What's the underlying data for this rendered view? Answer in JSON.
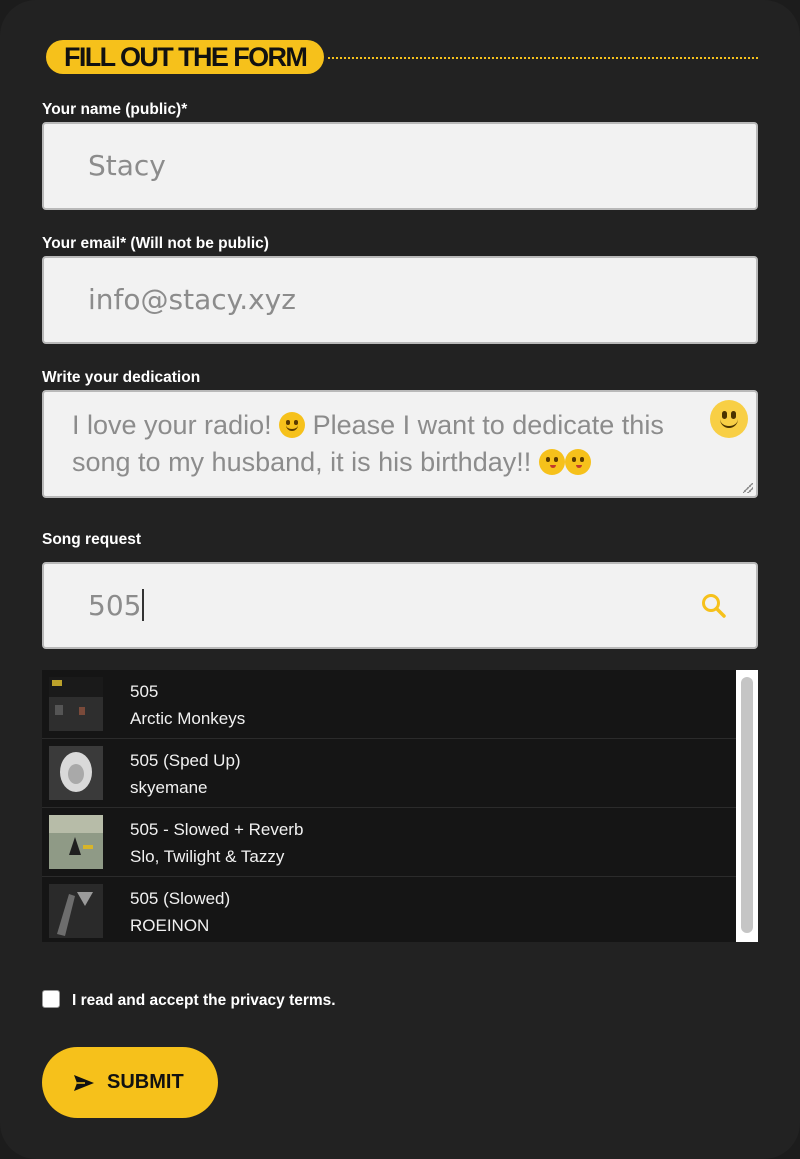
{
  "header": {
    "title": "FILL OUT THE FORM"
  },
  "name_field": {
    "label": "Your name (public)*",
    "value": "Stacy"
  },
  "email_field": {
    "label": "Your email* (Will not be public)",
    "value": "info@stacy.xyz"
  },
  "dedication_field": {
    "label": "Write your dedication",
    "text_part1": "I love your radio! ",
    "text_part2": " Please I want to dedicate this song to my husband, it is his birthday!! ",
    "emoji_button_icon": "smiley-icon"
  },
  "song_field": {
    "label": "Song request",
    "value": "505",
    "search_icon": "search-icon"
  },
  "results": [
    {
      "title": "505",
      "artist": "Arctic Monkeys"
    },
    {
      "title": "505 (Sped Up)",
      "artist": "skyemane"
    },
    {
      "title": "505 - Slowed + Reverb",
      "artist": "Slo, Twilight & Tazzy"
    },
    {
      "title": "505 (Slowed)",
      "artist": "ROEINON"
    }
  ],
  "privacy": {
    "label": "I read and accept the privacy terms.",
    "checked": false
  },
  "submit": {
    "label": "SUBMIT",
    "icon": "send-icon"
  },
  "colors": {
    "accent": "#f6c11b",
    "background": "#222222",
    "field_bg": "#f2f2f2"
  }
}
